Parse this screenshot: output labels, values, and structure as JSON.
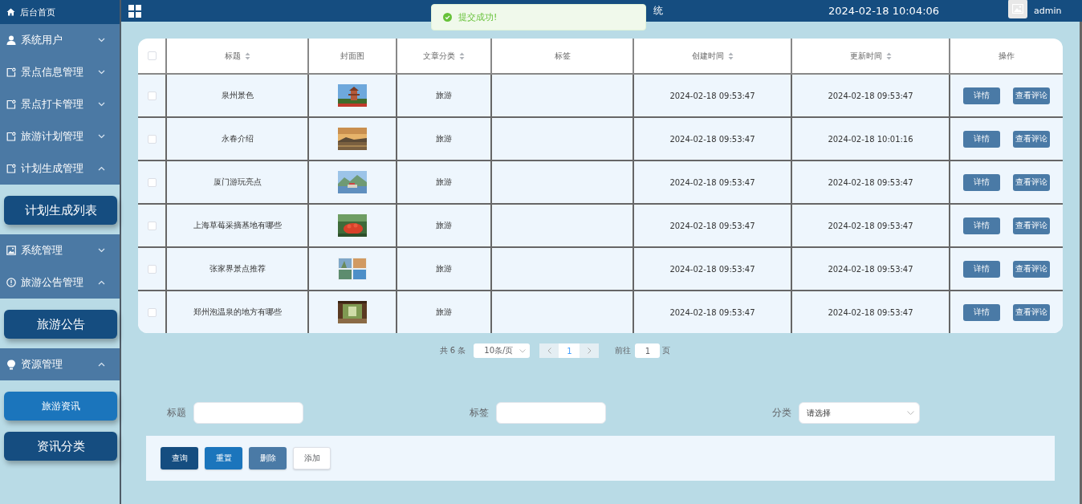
{
  "sidebar": {
    "home": {
      "label": "后台首页"
    },
    "groups": [
      {
        "label": "系统用户",
        "expanded": false
      },
      {
        "label": "景点信息管理",
        "expanded": false
      },
      {
        "label": "景点打卡管理",
        "expanded": false
      },
      {
        "label": "旅游计划管理",
        "expanded": false
      },
      {
        "label": "计划生成管理",
        "expanded": true,
        "children": [
          {
            "label": "计划生成列表",
            "selected": false
          }
        ]
      },
      {
        "label": "系统管理",
        "expanded": false
      },
      {
        "label": "旅游公告管理",
        "expanded": true,
        "children": [
          {
            "label": "旅游公告",
            "selected": false
          }
        ]
      },
      {
        "label": "资源管理",
        "expanded": true,
        "children": [
          {
            "label": "旅游资讯",
            "selected": true
          },
          {
            "label": "资讯分类",
            "selected": false
          }
        ]
      }
    ]
  },
  "header": {
    "title_visible": "统",
    "datetime": "2024-02-18 10:04:06",
    "user": "admin"
  },
  "toast": {
    "message": "提交成功!"
  },
  "table": {
    "select_all": {
      "checked": false
    },
    "columns": [
      {
        "label": "标题",
        "sortable": true
      },
      {
        "label": "封面图",
        "sortable": false
      },
      {
        "label": "文章分类",
        "sortable": true
      },
      {
        "label": "标签",
        "sortable": false
      },
      {
        "label": "创建时间",
        "sortable": true
      },
      {
        "label": "更新时间",
        "sortable": true
      },
      {
        "label": "操作",
        "sortable": false
      }
    ],
    "rows": [
      {
        "checked": false,
        "title": "泉州景色",
        "cover": {
          "kind": "picture"
        },
        "category": "旅游",
        "created": "2024-02-18 09:53:47",
        "updated": "2024-02-18 09:53:47",
        "actions": [
          "详情",
          "查看评论"
        ]
      },
      {
        "checked": false,
        "title": "永春介绍",
        "cover": {
          "kind": "picture"
        },
        "category": "旅游",
        "created": "2024-02-18 09:53:47",
        "updated": "2024-02-18 10:01:16",
        "actions": [
          "详情",
          "查看评论"
        ]
      },
      {
        "checked": false,
        "title": "厦门游玩亮点",
        "cover": {
          "kind": "picture"
        },
        "category": "旅游",
        "created": "2024-02-18 09:53:47",
        "updated": "2024-02-18 09:53:47",
        "actions": [
          "详情",
          "查看评论"
        ]
      },
      {
        "checked": false,
        "title": "上海草莓采摘基地有哪些",
        "cover": {
          "kind": "picture"
        },
        "category": "旅游",
        "created": "2024-02-18 09:53:47",
        "updated": "2024-02-18 09:53:47",
        "actions": [
          "详情",
          "查看评论"
        ]
      },
      {
        "checked": false,
        "title": "张家界景点推荐",
        "cover": {
          "kind": "picture"
        },
        "category": "旅游",
        "created": "2024-02-18 09:53:47",
        "updated": "2024-02-18 09:53:47",
        "actions": [
          "详情",
          "查看评论"
        ]
      },
      {
        "checked": false,
        "title": "郑州泡温泉的地方有哪些",
        "cover": {
          "kind": "picture"
        },
        "category": "旅游",
        "created": "2024-02-18 09:53:47",
        "updated": "2024-02-18 09:53:47",
        "actions": [
          "详情",
          "查看评论"
        ]
      }
    ]
  },
  "pagination": {
    "total": "共 6 条",
    "page_size": "10条/页",
    "pages": [
      {
        "label": "1",
        "selected": true
      }
    ],
    "goto_label": "前往",
    "goto_value": "1",
    "goto_suffix": "页"
  },
  "search": {
    "fields": [
      {
        "kind": "text",
        "label": "标题"
      },
      {
        "kind": "text",
        "label": "标签"
      },
      {
        "kind": "select",
        "label": "分类",
        "placeholder": "请选择"
      }
    ],
    "buttons": [
      {
        "kind": "primary",
        "label": "查询"
      },
      {
        "kind": "info",
        "label": "重置"
      },
      {
        "kind": "muted",
        "label": "删除"
      },
      {
        "kind": "plain",
        "label": "添加"
      }
    ]
  }
}
